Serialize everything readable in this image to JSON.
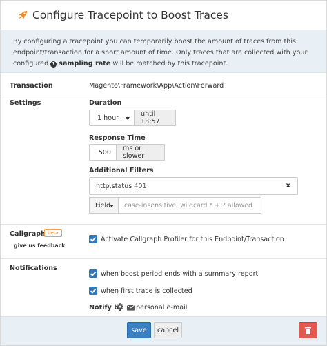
{
  "header": {
    "title": "Configure Tracepoint to Boost Traces"
  },
  "intro": {
    "text_part1": "By configuring a tracepoint you can temporarily boost the amount of traces from this endpoint/transaction for a short amount of time. Only traces that are collected with your configured",
    "sampling_rate": "sampling rate",
    "text_part2": "will be matched by this tracepoint."
  },
  "transaction": {
    "label": "Transaction",
    "value": "Magento\\Framework\\App\\Action\\Forward"
  },
  "settings": {
    "label": "Settings",
    "duration_label": "Duration",
    "duration_value": "1 hour",
    "duration_until": "until 13:57",
    "response_time_label": "Response Time",
    "response_time_value": "500",
    "response_time_unit": "ms or slower",
    "filters_label": "Additional Filters",
    "filter_key": "http.status",
    "filter_value": "401",
    "filter_remove": "x",
    "field_button": "Field",
    "field_placeholder": "case-insensitive, wildcard * + ? allowed"
  },
  "callgraphs": {
    "label": "Callgraphs",
    "badge": "beta",
    "feedback": "give us feedback",
    "checkbox_label": "Activate Callgraph Profiler for this Endpoint/Transaction",
    "checked": true
  },
  "notifications": {
    "label": "Notifications",
    "option1": "when boost period ends with a summary report",
    "option2": "when first trace is collected",
    "notify_by_label": "Notify by",
    "notify_channel": "personal e-mail"
  },
  "footer": {
    "save": "save",
    "cancel": "cancel"
  },
  "icons": {
    "header": "rocket-icon",
    "help": "question-circle-icon",
    "gear": "gear-icon",
    "email": "envelope-icon",
    "delete": "trash-icon",
    "check": "check-icon"
  },
  "colors": {
    "accent": "#3477b7",
    "rocket": "#f08a24",
    "danger": "#e4584f",
    "info_bg": "#e9f0f5",
    "badge": "#f0a04b"
  }
}
